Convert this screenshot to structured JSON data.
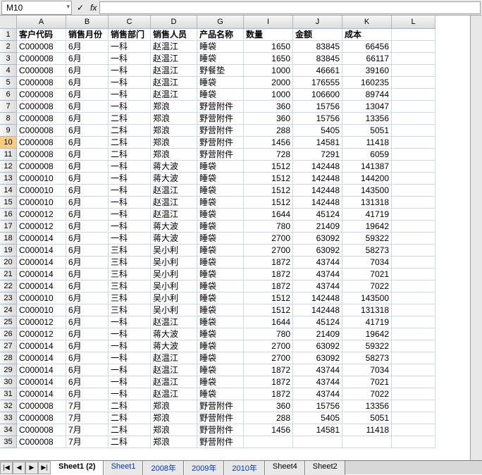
{
  "nameBox": "M10",
  "fxLabel": "fx",
  "columns": [
    "",
    "A",
    "B",
    "C",
    "D",
    "G",
    "I",
    "J",
    "K",
    "L"
  ],
  "headerRow": [
    "客户代码",
    "销售月份",
    "销售部门",
    "销售人员",
    "产品名称",
    "数量",
    "金额",
    "成本"
  ],
  "dataRows": [
    [
      "C000008",
      "6月",
      "一科",
      "赵温江",
      "睡袋",
      "1650",
      "83845",
      "66456"
    ],
    [
      "C000008",
      "6月",
      "一科",
      "赵温江",
      "睡袋",
      "1650",
      "83845",
      "66117"
    ],
    [
      "C000008",
      "6月",
      "一科",
      "赵温江",
      "野餐垫",
      "1000",
      "46661",
      "39160"
    ],
    [
      "C000008",
      "6月",
      "一科",
      "赵温江",
      "睡袋",
      "2000",
      "176555",
      "160235"
    ],
    [
      "C000008",
      "6月",
      "一科",
      "赵温江",
      "睡袋",
      "1000",
      "106600",
      "89744"
    ],
    [
      "C000008",
      "6月",
      "一科",
      "郑浪",
      "野营附件",
      "360",
      "15756",
      "13047"
    ],
    [
      "C000008",
      "6月",
      "二科",
      "郑浪",
      "野营附件",
      "360",
      "15756",
      "13356"
    ],
    [
      "C000008",
      "6月",
      "二科",
      "郑浪",
      "野营附件",
      "288",
      "5405",
      "5051"
    ],
    [
      "C000008",
      "6月",
      "二科",
      "郑浪",
      "野营附件",
      "1456",
      "14581",
      "11418"
    ],
    [
      "C000008",
      "6月",
      "二科",
      "郑浪",
      "野营附件",
      "728",
      "7291",
      "6059"
    ],
    [
      "C000008",
      "6月",
      "一科",
      "蒋大波",
      "睡袋",
      "1512",
      "142448",
      "141387"
    ],
    [
      "C000010",
      "6月",
      "一科",
      "蒋大波",
      "睡袋",
      "1512",
      "142448",
      "144200"
    ],
    [
      "C000010",
      "6月",
      "一科",
      "赵温江",
      "睡袋",
      "1512",
      "142448",
      "143500"
    ],
    [
      "C000010",
      "6月",
      "一科",
      "赵温江",
      "睡袋",
      "1512",
      "142448",
      "131318"
    ],
    [
      "C000012",
      "6月",
      "一科",
      "赵温江",
      "睡袋",
      "1644",
      "45124",
      "41719"
    ],
    [
      "C000012",
      "6月",
      "一科",
      "蒋大波",
      "睡袋",
      "780",
      "21409",
      "19642"
    ],
    [
      "C000014",
      "6月",
      "一科",
      "蒋大波",
      "睡袋",
      "2700",
      "63092",
      "59322"
    ],
    [
      "C000014",
      "6月",
      "三科",
      "吴小利",
      "睡袋",
      "2700",
      "63092",
      "58273"
    ],
    [
      "C000014",
      "6月",
      "三科",
      "吴小利",
      "睡袋",
      "1872",
      "43744",
      "7034"
    ],
    [
      "C000014",
      "6月",
      "三科",
      "吴小利",
      "睡袋",
      "1872",
      "43744",
      "7021"
    ],
    [
      "C000014",
      "6月",
      "三科",
      "吴小利",
      "睡袋",
      "1872",
      "43744",
      "7022"
    ],
    [
      "C000010",
      "6月",
      "三科",
      "吴小利",
      "睡袋",
      "1512",
      "142448",
      "143500"
    ],
    [
      "C000010",
      "6月",
      "三科",
      "吴小利",
      "睡袋",
      "1512",
      "142448",
      "131318"
    ],
    [
      "C000012",
      "6月",
      "一科",
      "赵温江",
      "睡袋",
      "1644",
      "45124",
      "41719"
    ],
    [
      "C000012",
      "6月",
      "一科",
      "蒋大波",
      "睡袋",
      "780",
      "21409",
      "19642"
    ],
    [
      "C000014",
      "6月",
      "一科",
      "蒋大波",
      "睡袋",
      "2700",
      "63092",
      "59322"
    ],
    [
      "C000014",
      "6月",
      "一科",
      "赵温江",
      "睡袋",
      "2700",
      "63092",
      "58273"
    ],
    [
      "C000014",
      "6月",
      "一科",
      "赵温江",
      "睡袋",
      "1872",
      "43744",
      "7034"
    ],
    [
      "C000014",
      "6月",
      "一科",
      "赵温江",
      "睡袋",
      "1872",
      "43744",
      "7021"
    ],
    [
      "C000014",
      "6月",
      "一科",
      "赵温江",
      "睡袋",
      "1872",
      "43744",
      "7022"
    ],
    [
      "C000008",
      "7月",
      "二科",
      "郑浪",
      "野营附件",
      "360",
      "15756",
      "13356"
    ],
    [
      "C000008",
      "7月",
      "二科",
      "郑浪",
      "野营附件",
      "288",
      "5405",
      "5051"
    ],
    [
      "C000008",
      "7月",
      "二科",
      "郑浪",
      "野营附件",
      "1456",
      "14581",
      "11418"
    ],
    [
      "C000008",
      "7月",
      "二科",
      "郑浪",
      "野营附件",
      "",
      "",
      ""
    ]
  ],
  "activeRow": 10,
  "chart_data": {
    "type": "table",
    "title": "",
    "columns": [
      "客户代码",
      "销售月份",
      "销售部门",
      "销售人员",
      "产品名称",
      "数量",
      "金额",
      "成本"
    ]
  },
  "sheetTabs": [
    {
      "label": "Sheet1 (2)",
      "active": true,
      "blue": false
    },
    {
      "label": "Sheet1",
      "active": false,
      "blue": true
    },
    {
      "label": "2008年",
      "active": false,
      "blue": true
    },
    {
      "label": "2009年",
      "active": false,
      "blue": true
    },
    {
      "label": "2010年",
      "active": false,
      "blue": true
    },
    {
      "label": "Sheet4",
      "active": false,
      "blue": false
    },
    {
      "label": "Sheet2",
      "active": false,
      "blue": false
    }
  ],
  "navSymbols": [
    "|◀",
    "◀",
    "▶",
    "▶|"
  ]
}
